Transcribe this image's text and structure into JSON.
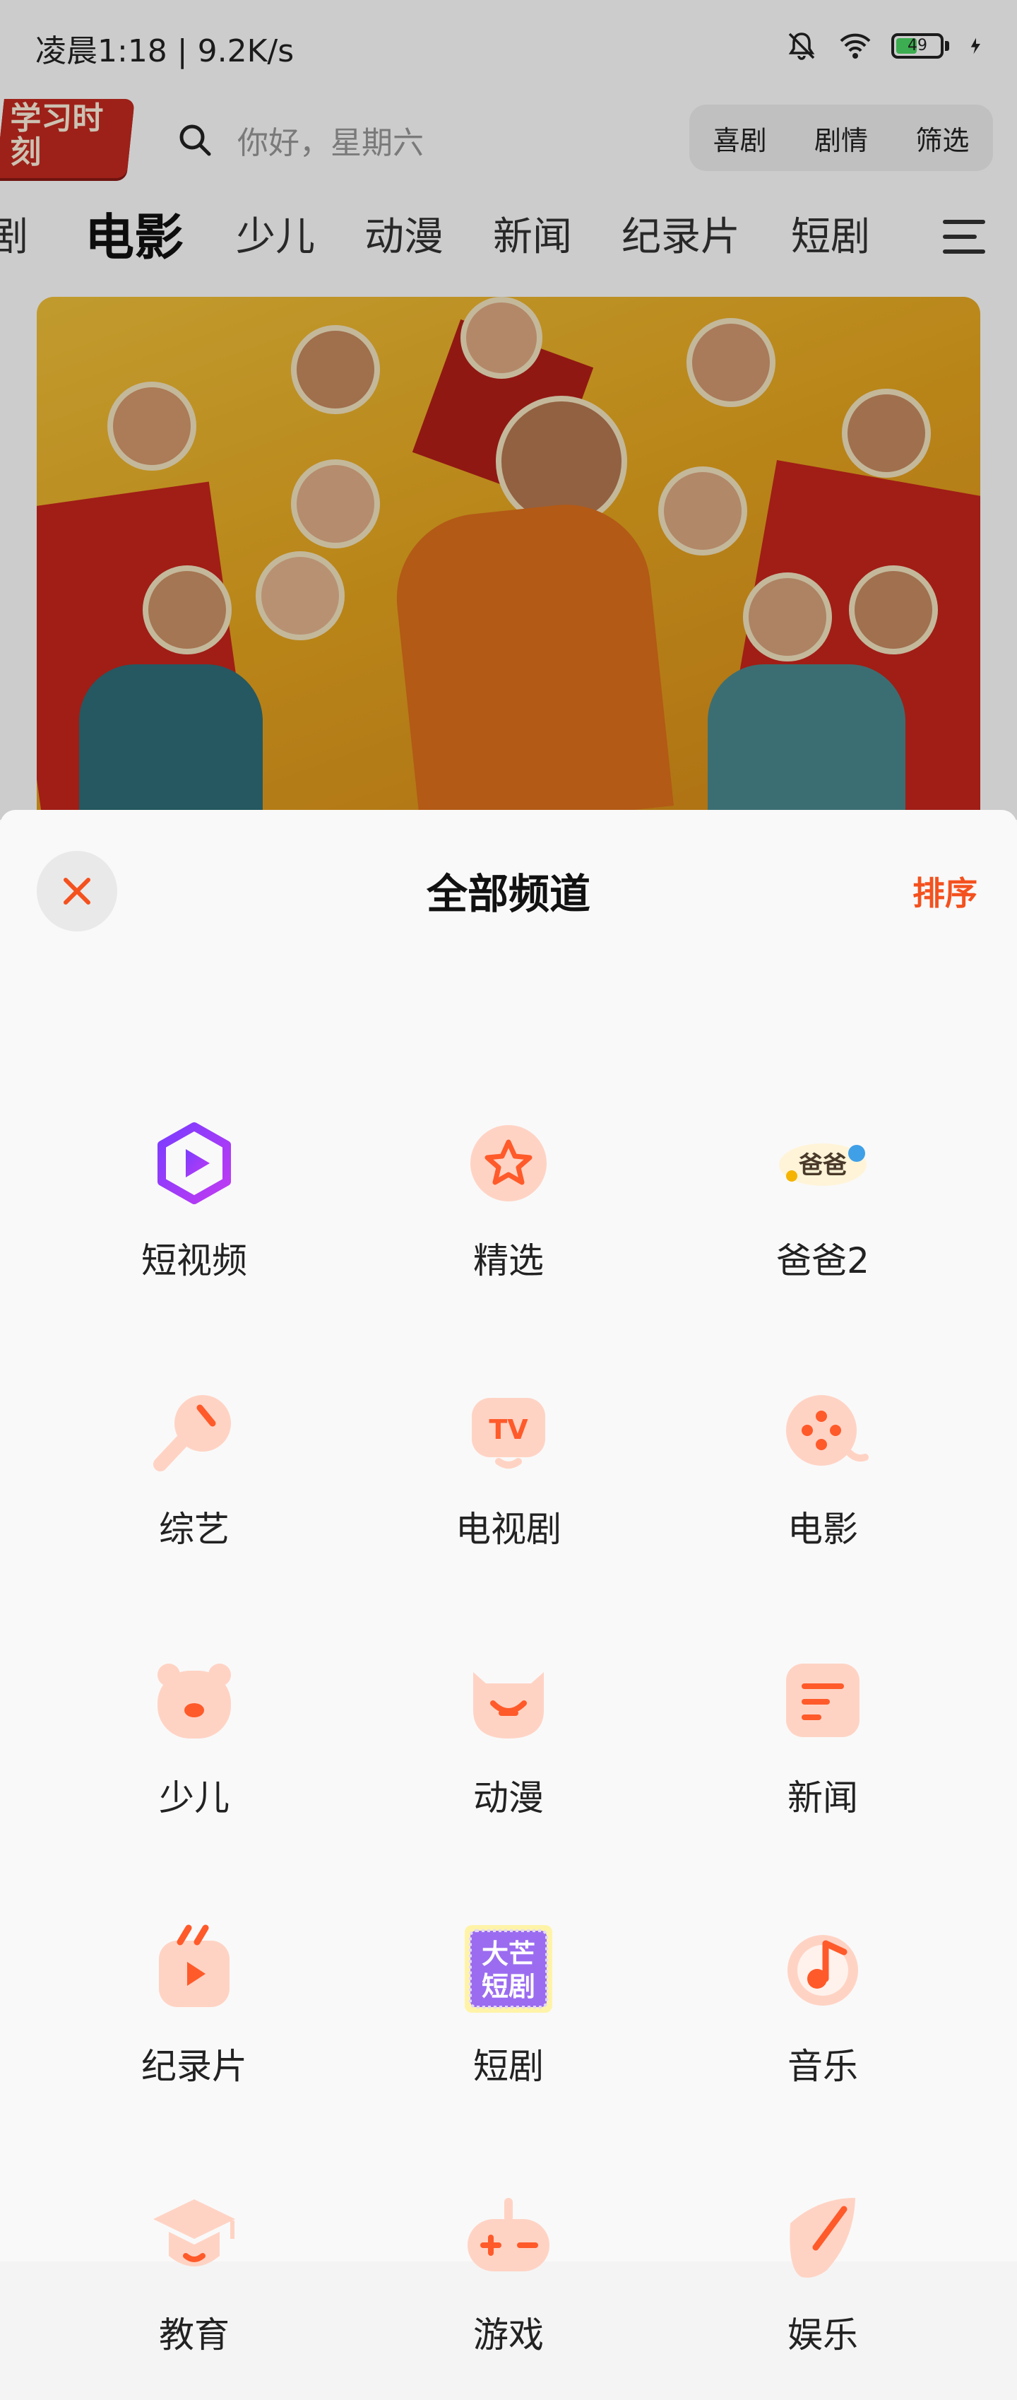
{
  "status_bar": {
    "time_speed": "凌晨1:18 | 9.2K/s",
    "battery": "49",
    "battery_level": 0.49
  },
  "header": {
    "logo": "学习时刻",
    "search_placeholder": "你好，星期六",
    "quick_filters": [
      "喜剧",
      "剧情",
      "筛选"
    ]
  },
  "channel_tabs": [
    "剧",
    "电影",
    "少儿",
    "动漫",
    "新闻",
    "纪录片",
    "短剧"
  ],
  "active_tab": "电影",
  "sheet": {
    "title": "全部频道",
    "sort_label": "排序",
    "channels": [
      {
        "label": "短视频",
        "icon": "short-video-icon"
      },
      {
        "label": "精选",
        "icon": "star-icon"
      },
      {
        "label": "爸爸2",
        "icon": "show-logo-icon"
      },
      {
        "label": "综艺",
        "icon": "microphone-icon"
      },
      {
        "label": "电视剧",
        "icon": "tv-icon"
      },
      {
        "label": "电影",
        "icon": "film-reel-icon"
      },
      {
        "label": "少儿",
        "icon": "bear-icon"
      },
      {
        "label": "动漫",
        "icon": "cartoon-face-icon"
      },
      {
        "label": "新闻",
        "icon": "news-icon"
      },
      {
        "label": "纪录片",
        "icon": "documentary-icon"
      },
      {
        "label": "短剧",
        "icon": "mini-drama-icon"
      },
      {
        "label": "音乐",
        "icon": "music-note-icon"
      },
      {
        "label": "教育",
        "icon": "graduation-cap-icon"
      },
      {
        "label": "游戏",
        "icon": "gamepad-icon"
      },
      {
        "label": "娱乐",
        "icon": "entertainment-icon"
      }
    ]
  },
  "colors": {
    "accent": "#f4511e",
    "icon_bg": "#ffd3c4",
    "icon_fg": "#ff5a2a"
  }
}
